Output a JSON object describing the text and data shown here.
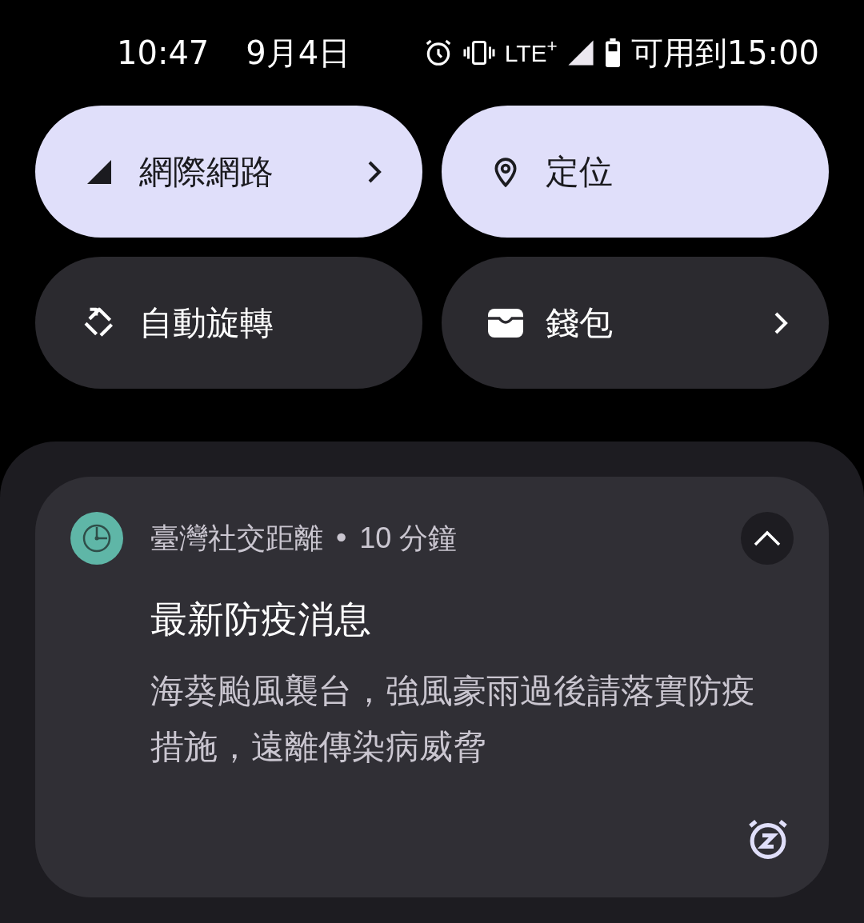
{
  "status_bar": {
    "time": "10:47",
    "date": "9月4日",
    "network": "LTE$^{+}$",
    "battery_text": "可用到15:00"
  },
  "tiles": [
    {
      "label": "網際網路",
      "kind": "signal",
      "on": true,
      "chevron": true
    },
    {
      "label": "定位",
      "kind": "location",
      "on": true,
      "chevron": false
    },
    {
      "label": "自動旋轉",
      "kind": "rotate",
      "on": false,
      "chevron": false
    },
    {
      "label": "錢包",
      "kind": "wallet",
      "on": false,
      "chevron": true
    }
  ],
  "notification": {
    "app": "臺灣社交距離",
    "separator": "•",
    "time": "10 分鐘",
    "expanded": true,
    "title": "最新防疫消息",
    "body": "海葵颱風襲台，強風豪雨過後請落實防疫措施，遠離傳染病威脅"
  }
}
